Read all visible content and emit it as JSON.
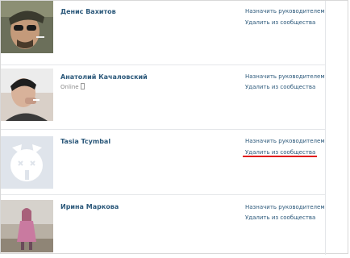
{
  "members": [
    {
      "name": "Денис Вахитов",
      "status": "",
      "actions": {
        "make_manager": "Назначить руководителем",
        "remove": "Удалить из сообщества"
      }
    },
    {
      "name": "Анатолий Качаловский",
      "status": "Online",
      "actions": {
        "make_manager": "Назначить руководителем",
        "remove": "Удалить из сообщества"
      }
    },
    {
      "name": "Tasia Tcymbal",
      "status": "",
      "actions": {
        "make_manager": "Назначить руководителем",
        "remove": "Удалить из сообщества"
      },
      "remove_highlighted": true,
      "highlight_color": "#e01010"
    },
    {
      "name": "Ирина Маркова",
      "status": "",
      "actions": {
        "make_manager": "Назначить руководителем",
        "remove": "Удалить из сообщества"
      }
    }
  ],
  "colors": {
    "link": "#2b587a",
    "divider": "#e4e6e9",
    "status": "#8a8a8a"
  }
}
